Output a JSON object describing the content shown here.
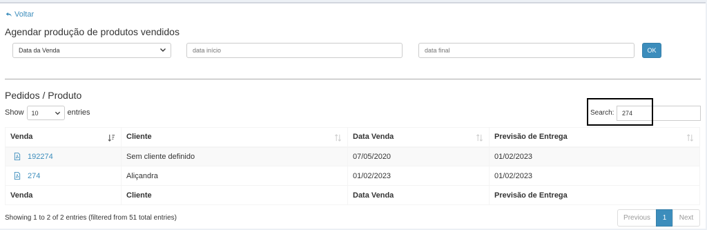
{
  "nav": {
    "back_label": "Voltar"
  },
  "page": {
    "title": "Agendar produção de produtos vendidos"
  },
  "filters": {
    "date_type_selected": "Data da Venda",
    "start_placeholder": "data início",
    "end_placeholder": "data final",
    "ok_label": "OK"
  },
  "section": {
    "title": "Pedidos / Produto"
  },
  "length": {
    "show_label": "Show",
    "value": "10",
    "entries_label": "entries"
  },
  "search": {
    "label": "Search:",
    "value": "274"
  },
  "table": {
    "columns": [
      "Venda",
      "Cliente",
      "Data Venda",
      "Previsão de Entrega"
    ],
    "rows": [
      {
        "venda": "192274",
        "cliente": "Sem cliente definido",
        "data_venda": "07/05/2020",
        "previsao": "01/02/2023"
      },
      {
        "venda": "274",
        "cliente": "Aliçandra",
        "data_venda": "01/02/2023",
        "previsao": "01/02/2023"
      }
    ]
  },
  "footer": {
    "info": "Showing 1 to 2 of 2 entries (filtered from 51 total entries)",
    "previous_label": "Previous",
    "page": "1",
    "next_label": "Next"
  },
  "colors": {
    "accent": "#3c8dbc",
    "highlight_border": "#000000"
  },
  "icons": {
    "back": "undo-arrow-icon",
    "pdf": "pdf-file-icon",
    "sort": "sort-icon",
    "chevron": "chevron-down-icon"
  }
}
